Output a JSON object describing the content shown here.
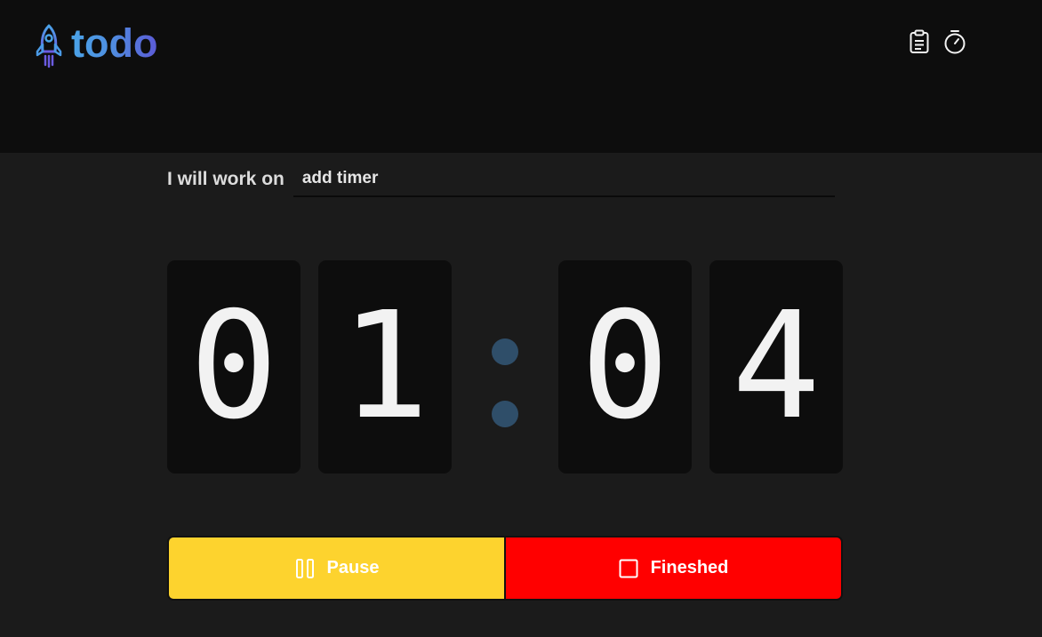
{
  "app": {
    "logo_text": "todo",
    "logo_icon": "rocket-icon"
  },
  "nav": {
    "items": [
      {
        "icon": "clipboard-icon"
      },
      {
        "icon": "stopwatch-icon"
      }
    ]
  },
  "task": {
    "label": "I will work on",
    "value": "add timer"
  },
  "timer": {
    "digits": [
      "0",
      "1",
      "0",
      "4"
    ],
    "separator_color": "#2f4e69"
  },
  "actions": {
    "pause": {
      "label": "Pause",
      "icon": "pause-icon",
      "color": "#fdd32e"
    },
    "finish": {
      "label": "Fineshed",
      "icon": "stop-icon",
      "color": "#ff0000"
    }
  },
  "colors": {
    "header_bg": "#0d0d0d",
    "page_bg": "#1b1b1b",
    "accent_gradient": [
      "#4aa3e8",
      "#5b5bd6"
    ]
  }
}
